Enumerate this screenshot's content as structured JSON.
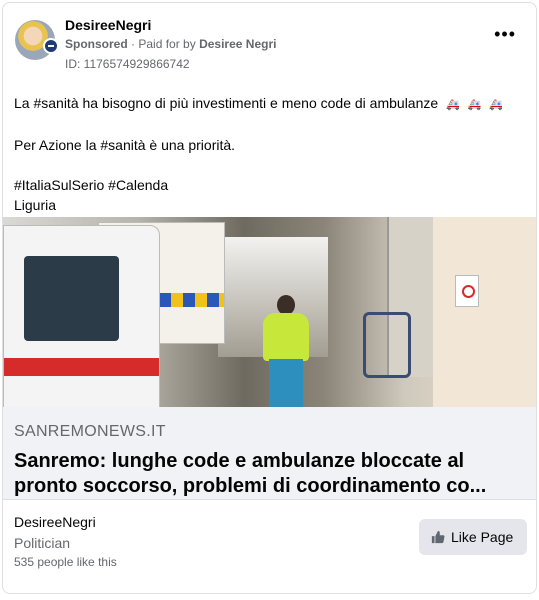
{
  "post": {
    "author": "DesireeNegri",
    "sponsored": "Sponsored",
    "paid_for_prefix": "Paid for by",
    "paid_for_name": "Desiree Negri",
    "id_label": "ID: 1176574929866742",
    "text": {
      "line1": "La #sanità ha bisogno di più investimenti e meno code di ambulanze",
      "line2": "Per Azione la #sanità è una priorità.",
      "hashtags": "#ItaliaSulSerio #Calenda",
      "location": "Liguria"
    }
  },
  "link": {
    "domain": "SANREMONEWS.IT",
    "headline": "Sanremo: lunghe code e ambulanze bloccate al pronto soccorso, problemi di coordinamento co..."
  },
  "page": {
    "name": "DesireeNegri",
    "category": "Politician",
    "likes": "535 people like this",
    "like_button": "Like Page"
  },
  "icons": {
    "more": "more-options-icon",
    "like": "thumbs-up-icon",
    "ambulance": "ambulance-emoji-icon"
  }
}
